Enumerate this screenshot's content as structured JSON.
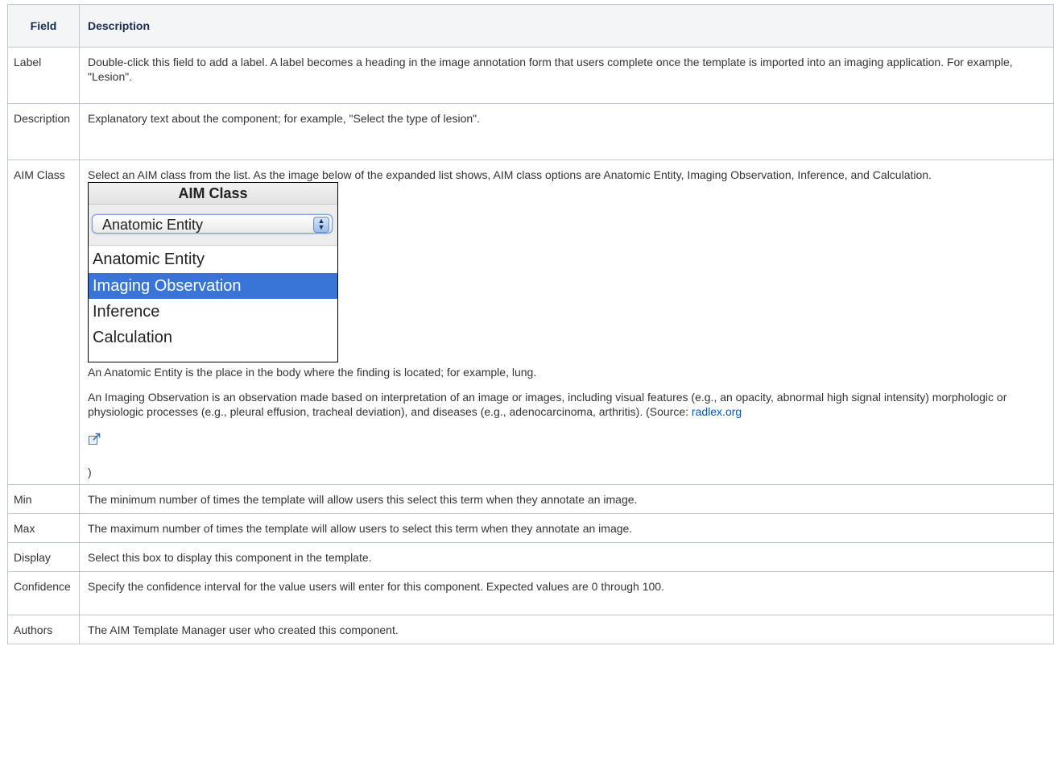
{
  "table": {
    "headers": {
      "field": "Field",
      "description": "Description"
    },
    "rows": [
      {
        "field": "Label",
        "description": "Double-click this field to add a label. A label becomes a heading in the image annotation form that users complete once the template is imported into an imaging application. For example, \"Lesion\"."
      },
      {
        "field": "Description",
        "description": "Explanatory text about the component; for example, \"Select the type of lesion\"."
      },
      {
        "field": "AIM Class"
      },
      {
        "field": "Min",
        "description": "The minimum number of times the template will allow users this select this term when they annotate an image."
      },
      {
        "field": "Max",
        "description": "The maximum number of times the template will allow users to select this term when they annotate an image."
      },
      {
        "field": "Display",
        "description": "Select this box to display this component in the template."
      },
      {
        "field": "Confidence",
        "description": "Specify the confidence interval for the value users will enter for this component. Expected values are 0 through 100."
      },
      {
        "field": "Authors",
        "description": "The AIM Template Manager user who created this component."
      }
    ]
  },
  "aim_class": {
    "intro": "Select an AIM class from the list. As the image below of the expanded list shows, AIM class options are Anatomic Entity, Imaging Observation, Inference, and Calculation.",
    "widget": {
      "header": "AIM Class",
      "selected_value": "Anatomic Entity",
      "options": [
        "Anatomic Entity",
        "Imaging Observation",
        "Inference",
        "Calculation"
      ],
      "highlighted_option": "Imaging Observation",
      "highlight_color": "#3875d7"
    },
    "anatomic_entity_text": "An Anatomic Entity is the place in the body where the finding is located; for example, lung.",
    "imaging_observation_text": "An Imaging Observation is an observation made based on interpretation of an image or images, including visual features (e.g., an opacity, abnormal high signal intensity) morphologic or physiologic processes (e.g., pleural effusion, tracheal deviation), and diseases (e.g., adenocarcinoma, arthritis). (Source: ",
    "source_link_text": "radlex.org",
    "external_link_icon": "external-link-icon",
    "closing_text": ")"
  },
  "colors": {
    "border": "#c1c7d0",
    "header_bg": "#f4f5f7",
    "link": "#0052cc"
  }
}
